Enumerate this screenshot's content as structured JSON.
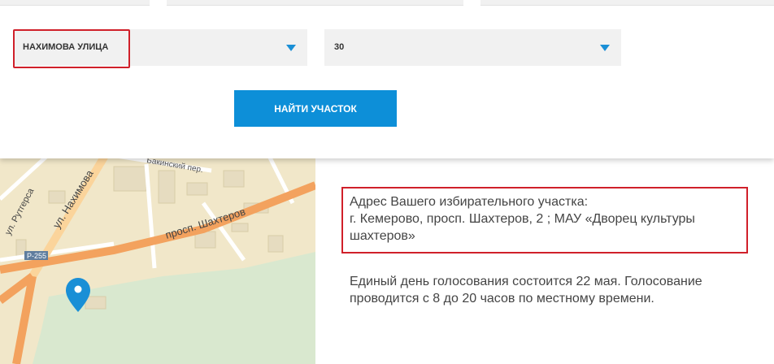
{
  "search": {
    "street_value": "НАХИМОВА УЛИЦА",
    "house_value": "30",
    "find_button_label": "НАЙТИ УЧАСТОК"
  },
  "map": {
    "street_labels": {
      "nakhimova": "ул. Нахимова",
      "shakhterov": "просп. Шахтеров",
      "rutgersa": "ул. Рутгерса",
      "bakinsky": "Бакинский пер.",
      "route": "Р-255"
    },
    "colors": {
      "land": "#f1e7c9",
      "park": "#d9e8cf",
      "road_major": "#f3a25e",
      "marker": "#1a8fd6"
    }
  },
  "result": {
    "address_line1": "Адрес Вашего избирательного участка:",
    "address_line2": "г. Кемерово, просп. Шахтеров, 2 ; МАУ «Дворец культуры шахтеров»",
    "info_text": "Единый день голосования состоится 22 мая. Голосование проводится с 8 до 20 часов по местному времени."
  },
  "colors": {
    "highlight": "#d0202a",
    "button": "#0d8fd8",
    "field_bg": "#f1f1f1"
  }
}
